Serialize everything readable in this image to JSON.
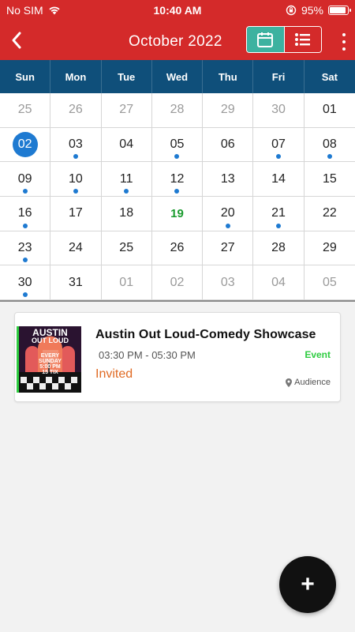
{
  "status_bar": {
    "carrier": "No SIM",
    "time": "10:40 AM",
    "battery": "95%"
  },
  "header": {
    "title": "October 2022"
  },
  "calendar": {
    "weekdays": [
      "Sun",
      "Mon",
      "Tue",
      "Wed",
      "Thu",
      "Fri",
      "Sat"
    ],
    "weeks": [
      [
        {
          "d": "25",
          "other": true
        },
        {
          "d": "26",
          "other": true
        },
        {
          "d": "27",
          "other": true
        },
        {
          "d": "28",
          "other": true
        },
        {
          "d": "29",
          "other": true
        },
        {
          "d": "30",
          "other": true
        },
        {
          "d": "01"
        }
      ],
      [
        {
          "d": "02",
          "selected": true
        },
        {
          "d": "03",
          "dot": true
        },
        {
          "d": "04"
        },
        {
          "d": "05",
          "dot": true
        },
        {
          "d": "06"
        },
        {
          "d": "07",
          "dot": true
        },
        {
          "d": "08",
          "dot": true
        }
      ],
      [
        {
          "d": "09",
          "dot": true
        },
        {
          "d": "10",
          "dot": true
        },
        {
          "d": "11",
          "dot": true
        },
        {
          "d": "12",
          "dot": true
        },
        {
          "d": "13"
        },
        {
          "d": "14"
        },
        {
          "d": "15"
        }
      ],
      [
        {
          "d": "16",
          "dot": true
        },
        {
          "d": "17"
        },
        {
          "d": "18"
        },
        {
          "d": "19",
          "today": true
        },
        {
          "d": "20",
          "dot": true
        },
        {
          "d": "21",
          "dot": true
        },
        {
          "d": "22"
        }
      ],
      [
        {
          "d": "23",
          "dot": true
        },
        {
          "d": "24"
        },
        {
          "d": "25"
        },
        {
          "d": "26"
        },
        {
          "d": "27"
        },
        {
          "d": "28"
        },
        {
          "d": "29"
        }
      ],
      [
        {
          "d": "30",
          "dot": true
        },
        {
          "d": "31"
        },
        {
          "d": "01",
          "other": true
        },
        {
          "d": "02",
          "other": true
        },
        {
          "d": "03",
          "other": true
        },
        {
          "d": "04",
          "other": true
        },
        {
          "d": "05",
          "other": true
        }
      ]
    ]
  },
  "event": {
    "title": "Austin Out Loud-Comedy Showcase",
    "time": "03:30 PM - 05:30 PM",
    "type": "Event",
    "status": "Invited",
    "location": "Audience",
    "thumb": {
      "line1": "AUSTIN",
      "line2": "OUT LOUD",
      "line3": "EVERY",
      "line4": "SUNDAY",
      "line5": "5:00 PM",
      "line6": "15 TIX"
    }
  },
  "colors": {
    "header": "#d42a2a",
    "weekday_bar": "#0f4f7a",
    "selected": "#1e7ad1",
    "today": "#1a9b2e",
    "event_type": "#2ecc40",
    "status": "#e06a23",
    "toggle_active": "#3db2a0"
  }
}
